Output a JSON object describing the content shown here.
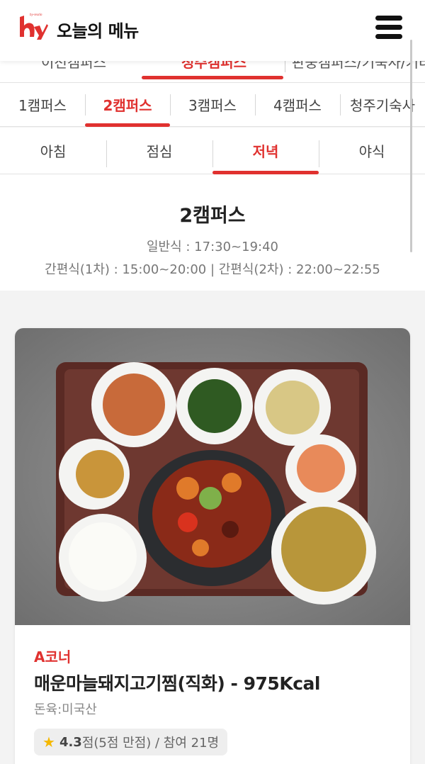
{
  "header": {
    "title": "오늘의 메뉴",
    "logo_text": "by-textin"
  },
  "top_row": {
    "items": [
      "이천캠퍼스",
      "청주캠퍼스",
      "판중캠퍼스/기숙사/기타"
    ]
  },
  "campus_tabs": [
    {
      "label": "1캠퍼스",
      "active": false
    },
    {
      "label": "2캠퍼스",
      "active": true
    },
    {
      "label": "3캠퍼스",
      "active": false
    },
    {
      "label": "4캠퍼스",
      "active": false
    },
    {
      "label": "청주기숙사",
      "active": false
    }
  ],
  "meal_tabs": [
    {
      "label": "아침",
      "active": false
    },
    {
      "label": "점심",
      "active": false
    },
    {
      "label": "저녁",
      "active": true
    },
    {
      "label": "야식",
      "active": false
    }
  ],
  "info": {
    "title": "2캠퍼스",
    "line1": "일반식 : 17:30~19:40",
    "line2": "간편식(1차) : 15:00~20:00 | 간편식(2차) : 22:00~22:55"
  },
  "menu_card": {
    "corner": "A코너",
    "dish": "매운마늘돼지고기찜(직화) - 975Kcal",
    "origin": "돈육:미국산",
    "rating_score": "4.3",
    "rating_rest": "점(5점 만점) / 참여 21명"
  },
  "colors": {
    "accent": "#e0312f",
    "star": "#f5b800"
  }
}
